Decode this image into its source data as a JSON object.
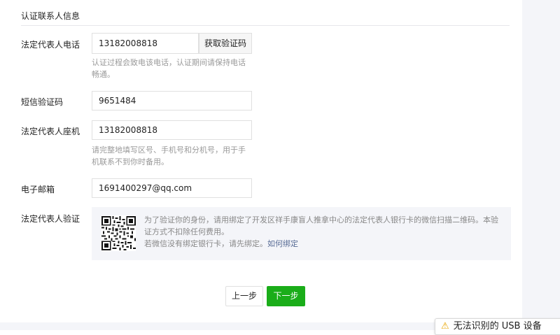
{
  "section": {
    "title": "认证联系人信息"
  },
  "phone": {
    "label": "法定代表人电话",
    "value": "13182008818",
    "get_code_label": "获取验证码",
    "hint_line1": "认证过程会致电该电话，认证期间请保持电话",
    "hint_line2": "畅通。"
  },
  "sms": {
    "label": "短信验证码",
    "value": "9651484"
  },
  "landline": {
    "label": "法定代表人座机",
    "value": "13182008818",
    "hint_line1": "请完整地填写区号、手机号和分机号，用于手",
    "hint_line2": "机联系不到你时备用。"
  },
  "email": {
    "label": "电子邮箱",
    "value": "1691400297@qq.com"
  },
  "verify": {
    "label": "法定代表人验证",
    "text_line1": "为了验证你的身份，请用绑定了开发区祥手康盲人推拿中心的法定代表人银行卡的微信扫描二维码。本验",
    "text_line2": "证方式不扣除任何费用。",
    "text_line3": "若微信没有绑定银行卡，请先绑定。",
    "how_to_bind": "如何绑定"
  },
  "actions": {
    "prev": "上一步",
    "next": "下一步"
  },
  "toast": {
    "icon": "warning-icon",
    "text": "无法识别的 USB 设备"
  },
  "colors": {
    "primary_green": "#1aad19",
    "link_blue": "#576b95",
    "panel_bg": "#f4f5f9"
  }
}
